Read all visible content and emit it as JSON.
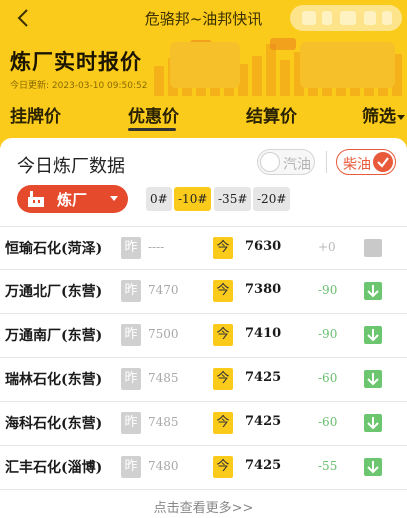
{
  "header": {
    "app_title": "危骆邦~油邦快讯",
    "page_title": "炼厂实时报价",
    "update_time": "今日更新: 2023-03-10 09:50:52"
  },
  "tabs": [
    {
      "label": "挂牌价",
      "active": false
    },
    {
      "label": "优惠价",
      "active": true
    },
    {
      "label": "结算价",
      "active": false
    },
    {
      "label": "筛选",
      "active": false
    }
  ],
  "panel": {
    "title": "今日炼厂数据",
    "gasoline_toggle": "汽油",
    "diesel_toggle": "柴油",
    "refinery_button": "炼厂",
    "grades": [
      "0#",
      "-10#",
      "-35#",
      "-20#"
    ],
    "selected_grade": "-10#",
    "yesterday_badge": "昨",
    "today_badge": "今"
  },
  "rows": [
    {
      "name": "恒瑜石化(菏泽)",
      "yesterday": "----",
      "today": "7630",
      "change": "+0",
      "trend": "flat"
    },
    {
      "name": "万通北厂(东营)",
      "yesterday": "7470",
      "today": "7380",
      "change": "-90",
      "trend": "down"
    },
    {
      "name": "万通南厂(东营)",
      "yesterday": "7500",
      "today": "7410",
      "change": "-90",
      "trend": "down"
    },
    {
      "name": "瑞林石化(东营)",
      "yesterday": "7485",
      "today": "7425",
      "change": "-60",
      "trend": "down"
    },
    {
      "name": "海科石化(东营)",
      "yesterday": "7485",
      "today": "7425",
      "change": "-60",
      "trend": "down"
    },
    {
      "name": "汇丰石化(淄博)",
      "yesterday": "7480",
      "today": "7425",
      "change": "-55",
      "trend": "down"
    }
  ],
  "more_link": "点击查看更多>>",
  "colors": {
    "brand_yellow": "#fbcb1c",
    "accent_red": "#e54a2c",
    "down_green": "#6cc56f"
  }
}
